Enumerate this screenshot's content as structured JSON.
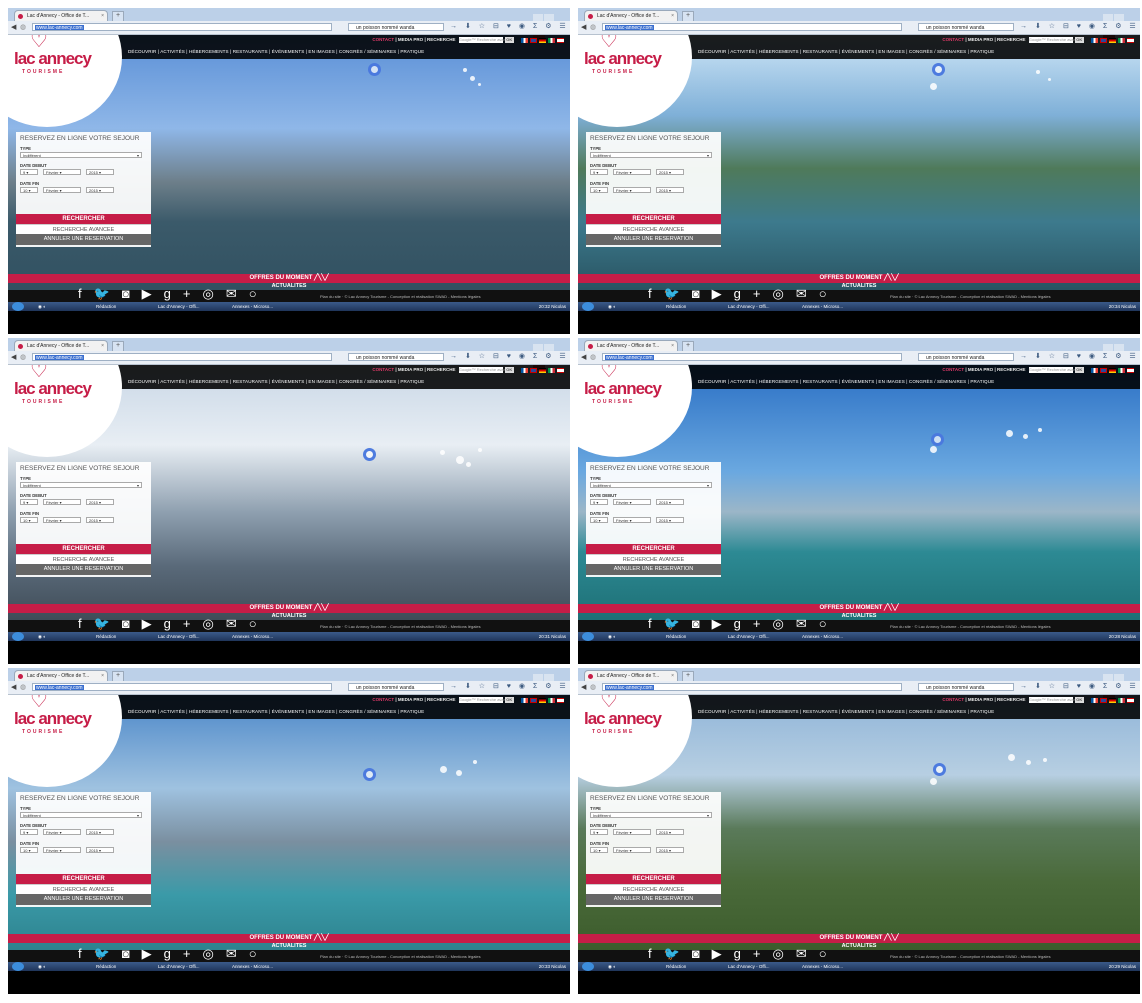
{
  "browser": {
    "tab_title": "Lac d'Annecy - Office de T...",
    "new_tab": "+",
    "url": "www.lac-annecy.com",
    "search_text": "un poisson nommé wanda"
  },
  "site": {
    "util": {
      "contact": "CONTACT",
      "media": "MEDIA PRO",
      "search": "RECHERCHE",
      "google_placeholder": "Google™ Recherche avancé",
      "ok": "OK"
    },
    "menu": "DÉCOUVRIR | ACTIVITÉS | HÉBERGEMENTS | RESTAURANTS | ÉVÉNEMENTS | EN IMAGES | CONGRÈS / SÉMINAIRES | PRATIQUE",
    "logo_text": "lac annecy",
    "logo_sub": "TOURISME"
  },
  "form": {
    "title": "RESERVEZ EN LIGNE VOTRE SEJOUR",
    "type_label": "TYPE",
    "type_value": "Indifférent",
    "start_label": "DATE DEBUT",
    "start_day": "9",
    "start_month": "Février",
    "start_year": "2015",
    "end_label": "DATE FIN",
    "end_day": "10",
    "end_month": "Février",
    "end_year": "2015",
    "search_button": "RECHERCHER",
    "advanced_button": "RECHERCHE AVANCEE",
    "cancel_button": "ANNULER UNE RESERVATION"
  },
  "offers": "OFFRES DU MOMENT",
  "news": "ACTUALITES",
  "footer": {
    "social": [
      "facebook-icon",
      "twitter-icon",
      "instagram-icon",
      "youtube-icon",
      "googleplus-icon",
      "weibo-icon",
      "mail-icon",
      "search-icon"
    ],
    "credits": "Plan du site · © Lac Annecy Tourisme - Conception et réalisation SWAD - Mentions légales"
  },
  "taskbar": {
    "item1": "Rédaction",
    "item2": "Lac d'Annecy - Offi...",
    "item3": "Annexes - Microso...",
    "clocks": [
      "20:32 Nicolas",
      "20:34 Nicolas",
      "20:31 Nicolas",
      "20:28 Nicolas",
      "20:33 Nicolas",
      "20:29 Nicolas"
    ]
  },
  "colors": {
    "brand": "#c61d47",
    "bubble_ring": "#3c6edc"
  }
}
